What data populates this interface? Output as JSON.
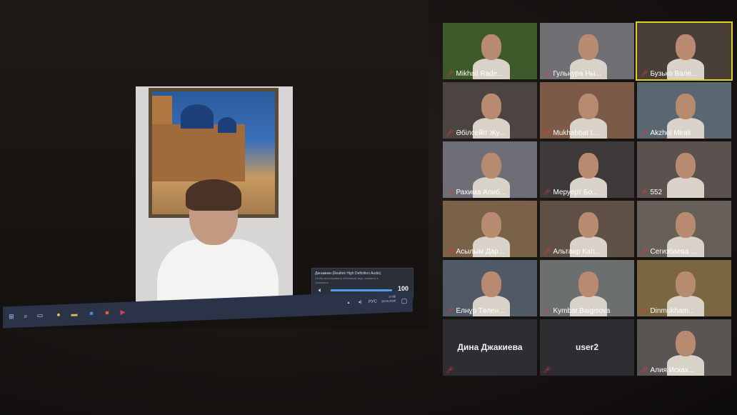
{
  "meeting": {
    "speaker_view": {
      "volume_popup": {
        "device": "Динамики (Realtek High Definition Audio)",
        "note": "Чтобы использовать объемный звук, нажмите в",
        "sub": "Громкость",
        "value": "100",
        "level": 1.0
      },
      "taskbar": {
        "time": "17:08",
        "date": "28.04.2020"
      }
    },
    "gallery": {
      "participants": [
        {
          "name": "Mikhail Rade...",
          "muted": true
        },
        {
          "name": "Гульнура Ны...",
          "muted": true
        },
        {
          "name": "Бузько Вале...",
          "muted": true
        },
        {
          "name": "Әбілсейіт Жу...",
          "muted": true
        },
        {
          "name": "Mukhabbat I...",
          "muted": true
        },
        {
          "name": "Akzhol Mirali",
          "muted": true
        },
        {
          "name": "Рахима Алиб...",
          "muted": true
        },
        {
          "name": "Меруерт Бо...",
          "muted": true
        },
        {
          "name": "552",
          "muted": true
        },
        {
          "name": "Асылым Дар...",
          "muted": true
        },
        {
          "name": "Альтаир Кал...",
          "muted": true
        },
        {
          "name": "Сегизбаева ...",
          "muted": true
        },
        {
          "name": "Елнұр Төлен...",
          "muted": true
        },
        {
          "name": "Kymbat Baigisova",
          "muted": true
        },
        {
          "name": "Dinmukham...",
          "muted": true
        },
        {
          "name": "Дина Джакиева",
          "muted": true,
          "no_video": true
        },
        {
          "name": "user2",
          "muted": true,
          "no_video": true
        },
        {
          "name": "Алия Исках...",
          "muted": true
        }
      ]
    },
    "colors": {
      "mute_icon": "#e23a3a",
      "active_speaker": "#e0d020",
      "taskbar": "#2a3348",
      "volume_accent": "#4f9ff0"
    }
  }
}
